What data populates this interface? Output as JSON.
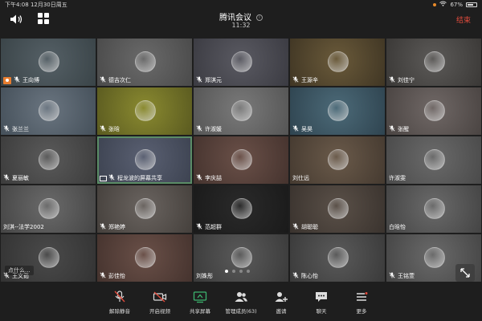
{
  "status": {
    "time_date": "下午4:08   12月30日周五",
    "battery": "67%",
    "battery_level": 0.67
  },
  "header": {
    "title": "腾讯会议",
    "duration": "11:32",
    "end_label": "结束"
  },
  "tiles": [
    {
      "name": "王向博",
      "host": true,
      "color_a": "#556066",
      "color_b": "#3a4448"
    },
    {
      "name": "德吉次仁",
      "color_a": "#6a6a6a",
      "color_b": "#4a4a4a"
    },
    {
      "name": "郑淇元",
      "color_a": "#5a5a62",
      "color_b": "#3b3b42"
    },
    {
      "name": "王源辛",
      "color_a": "#6a5a3a",
      "color_b": "#403624"
    },
    {
      "name": "刘佳宁",
      "color_a": "#5c5a58",
      "color_b": "#3a3836"
    },
    {
      "name": "张兰兰",
      "color_a": "#6a7580",
      "color_b": "#45505a"
    },
    {
      "name": "张晗",
      "color_a": "#8a8a30",
      "color_b": "#5a5a20"
    },
    {
      "name": "许淑媛",
      "color_a": "#7a7a7a",
      "color_b": "#555555"
    },
    {
      "name": "吴昊",
      "color_a": "#4c6a78",
      "color_b": "#2f4450"
    },
    {
      "name": "张醒",
      "color_a": "#706866",
      "color_b": "#4a4442"
    },
    {
      "name": "夏丽敏",
      "color_a": "#5a5a5a",
      "color_b": "#3c3c3c"
    },
    {
      "name": "程龙波的屏幕共享",
      "share": true,
      "color_a": "#5a6072",
      "color_b": "#3c4250"
    },
    {
      "name": "李庆喆",
      "color_a": "#6a5048",
      "color_b": "#45332e"
    },
    {
      "name": "刘仕远",
      "nomic": true,
      "color_a": "#6a5a4a",
      "color_b": "#453a30"
    },
    {
      "name": "许淑雯",
      "nomic": true,
      "color_a": "#6a6a6a",
      "color_b": "#4a4a4a"
    },
    {
      "name": "刘淇--法学2002",
      "nomic": true,
      "color_a": "#6a6a6a",
      "color_b": "#454545"
    },
    {
      "name": "郑艳婷",
      "color_a": "#6a6460",
      "color_b": "#45403c"
    },
    {
      "name": "范超群",
      "color_a": "#2a2a2a",
      "color_b": "#1a1a1a"
    },
    {
      "name": "胡聪聪",
      "color_a": "#5a5048",
      "color_b": "#3a332e"
    },
    {
      "name": "白晗怡",
      "nomic": true,
      "color_a": "#6a6a6a",
      "color_b": "#444444"
    },
    {
      "name": "王文茹",
      "color_a": "#4a4a4a",
      "color_b": "#333333"
    },
    {
      "name": "彭佳怡",
      "color_a": "#6a5048",
      "color_b": "#45332e"
    },
    {
      "name": "刘姝彤",
      "nomic": true,
      "color_a": "#5a5a5a",
      "color_b": "#3a3a3a"
    },
    {
      "name": "陈心怡",
      "color_a": "#5a5a5a",
      "color_b": "#3a3a3a"
    },
    {
      "name": "王铭萱",
      "color_a": "#6a6a6a",
      "color_b": "#454545"
    }
  ],
  "overlay": {
    "chat_hint": "点什么..."
  },
  "toolbar": {
    "unmute": "解除静音",
    "video": "开启视频",
    "share": "共享屏幕",
    "members": "管理成员(63)",
    "invite": "邀请",
    "chat": "聊天",
    "more": "更多"
  }
}
